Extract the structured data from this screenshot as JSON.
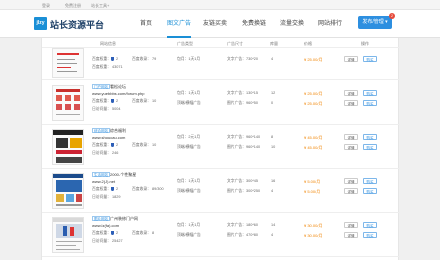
{
  "topbar": {
    "links": [
      "登录",
      "免费注册",
      "站长工具+"
    ]
  },
  "header": {
    "logo_mark": "jlzy",
    "logo_text": "站长资源平台",
    "nav": [
      "首页",
      "图文广告",
      "友链买卖",
      "免费换链",
      "流量交换",
      "网站排行"
    ],
    "active_nav_index": 1,
    "publish_label": "发布/管理 ▾",
    "badge_count": "2"
  },
  "table": {
    "columns": [
      "网站信息",
      "广告类型",
      "广告尺寸",
      "库量",
      "价格",
      "操作"
    ],
    "first_row_partial": {
      "b_value": "2",
      "trust_value": "79",
      "weight_text": "百度收录：",
      "traffic_text": "百度权重：",
      "ip": "43071",
      "ad_type_1": "包月：1天1月",
      "ad_type_2": "文字广告：730*20",
      "stock": "4",
      "price": "¥ 25.00/月"
    },
    "rows": [
      {
        "tag": "门户网站",
        "site_name": "看松论坛",
        "url": "www.yuebbbs.com/forum.php",
        "b_value": "2",
        "shoulu": "10",
        "daily_label": "日访问量：",
        "daily": "5004",
        "trust": "100",
        "ad_type_1": "包月：1天1月",
        "ad_type_2": "顶端/横幅广告",
        "size_1": "文字广告：130*15",
        "size_2": "图片广告：960*50",
        "stock_1": "12",
        "stock_2": "0",
        "price_1": "¥ 25.00/月",
        "price_2": "¥ 25.00/月"
      },
      {
        "tag": "综合网站",
        "site_name": "综合福利",
        "url": "www.shoucau.com",
        "b_value": "2",
        "shoulu": "10",
        "daily_label": "日访问量：",
        "daily": "246",
        "trust": "100",
        "ad_type_1": "包月：2元1月",
        "ad_type_2": "顶端/横幅广告",
        "size_1": "文字广告：960*140",
        "size_2": "图片广告：960*140",
        "stock_1": "8",
        "stock_2": "10",
        "price_1": "¥ 45.00/月",
        "price_2": "¥ 45.00/月"
      },
      {
        "tag": "生活网站",
        "site_name": "2000-个性聚星",
        "url": "www.2(J).net",
        "b_value": "2",
        "shoulu": "89/300",
        "daily_label": "日访问量：",
        "daily": "1829",
        "trust": "100/300",
        "ad_type_1": "包月：1天1月",
        "ad_type_2": "顶端/横幅广告",
        "size_1": "文字广告：300*45",
        "size_2": "图片广告：300*250",
        "stock_1": "16",
        "stock_2": "4",
        "price_1": "¥ 5.00/月",
        "price_2": "¥ 5.00/月"
      },
      {
        "tag": "图片网站",
        "site_name": "广州装修门户网",
        "url": "www.lz(fa).com",
        "b_value": "2",
        "shoulu": "8",
        "daily_label": "日访问量：",
        "daily": "25427",
        "trust": "8",
        "ad_type_1": "包月：1天1月",
        "ad_type_2": "顶端/横幅广告",
        "size_1": "文字广告：180*60",
        "size_2": "图片广告：470*80",
        "stock_1": "14",
        "stock_2": "4",
        "price_1": "¥ 30.00/月",
        "price_2": "¥ 30.00/月"
      }
    ],
    "labels": {
      "shoulu": "百度收录：",
      "trust": "百度权重：",
      "detail_button": "详情",
      "buy_button": "购买"
    }
  },
  "colors": {
    "accent": "#2d8fe0",
    "price": "#f08300",
    "badge": "#e64b3c"
  }
}
